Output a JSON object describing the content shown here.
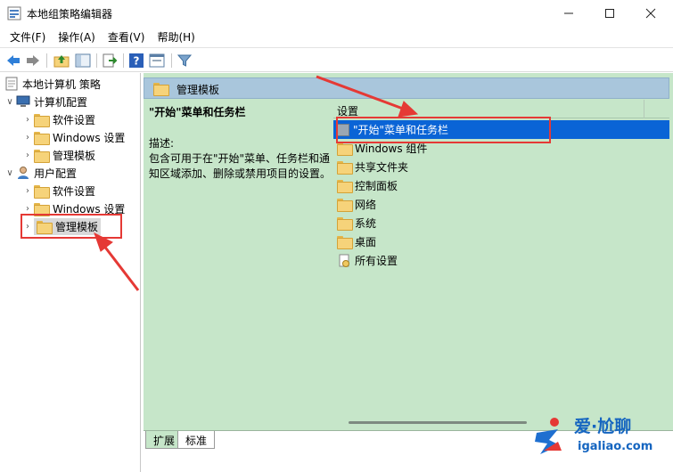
{
  "window": {
    "title": "本地组策略编辑器"
  },
  "menu": [
    "文件(F)",
    "操作(A)",
    "查看(V)",
    "帮助(H)"
  ],
  "tree": {
    "root": "本地计算机 策略",
    "computer": {
      "label": "计算机配置",
      "children": [
        "软件设置",
        "Windows 设置",
        "管理模板"
      ]
    },
    "user": {
      "label": "用户配置",
      "children": [
        "软件设置",
        "Windows 设置",
        "管理模板"
      ]
    }
  },
  "right_pane": {
    "header": "管理模板",
    "description": {
      "title": "\"开始\"菜单和任务栏",
      "label": "描述:",
      "text": "包含可用于在\"开始\"菜单、任务栏和通知区域添加、删除或禁用项目的设置。"
    },
    "list_header": "设置",
    "items": [
      "\"开始\"菜单和任务栏",
      "Windows 组件",
      "共享文件夹",
      "控制面板",
      "网络",
      "系统",
      "桌面",
      "所有设置"
    ]
  },
  "tabs": [
    "扩展",
    "标准"
  ],
  "watermark": {
    "line1": "爱·尬聊",
    "line2": "igaliao.com"
  },
  "colors": {
    "annotation": "#e53935",
    "selection": "#0a64d6",
    "pane_bg": "#c6e6c9"
  }
}
